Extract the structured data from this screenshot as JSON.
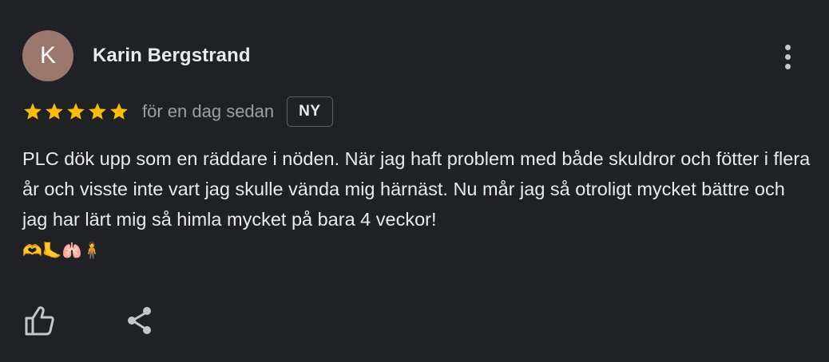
{
  "review": {
    "author_initial": "K",
    "author_name": "Karin Bergstrand",
    "rating": 5,
    "rating_max": 5,
    "date": "för en dag sedan",
    "badge": "NY",
    "text": "PLC dök upp som en räddare i nöden. När jag haft problem med både skuldror och fötter i flera år och visste inte vart jag skulle vända mig härnäst. Nu mår jag så otroligt mycket bättre och jag har lärt mig så himla mycket på bara 4 veckor!",
    "emojis": "🫶🦶🫁🧍"
  },
  "colors": {
    "background": "#202124",
    "avatar": "#9c776d",
    "star": "#fbbc04",
    "text": "#e8eaed",
    "secondary_text": "#9aa0a6"
  },
  "icons": {
    "more": "more-vert-icon",
    "star": "star-icon",
    "like": "thumb-up-icon",
    "share": "share-icon"
  }
}
